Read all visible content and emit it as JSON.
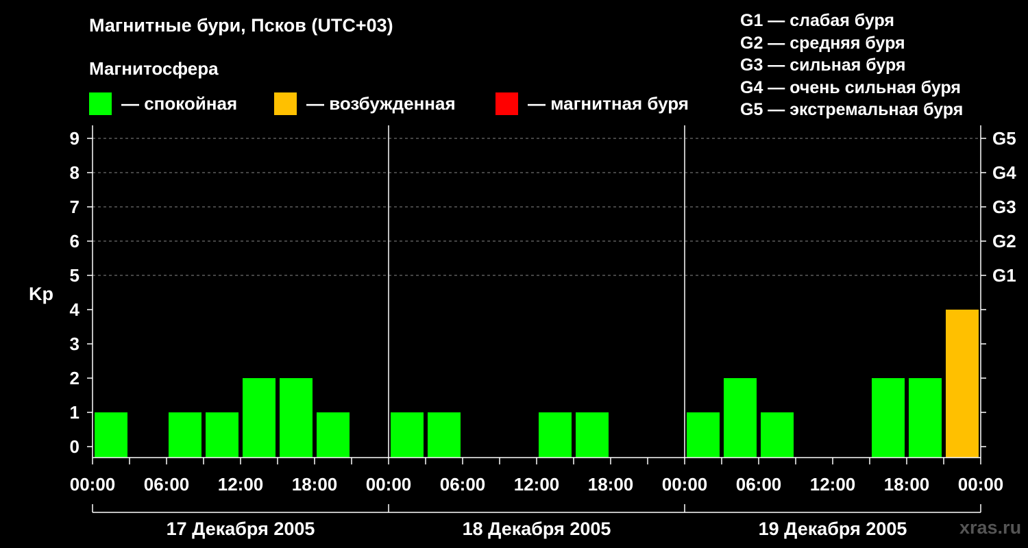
{
  "header": {
    "title": "Магнитные бури, Псков (UTC+03)",
    "subtitle": "Магнитосфера"
  },
  "legend": [
    {
      "label": "— спокойная",
      "color": "#00ff00"
    },
    {
      "label": "— возбужденная",
      "color": "#ffc000"
    },
    {
      "label": "— магнитная буря",
      "color": "#ff0000"
    }
  ],
  "storm_levels": [
    "G1 — слабая буря",
    "G2 — средняя буря",
    "G3 — сильная буря",
    "G4 — очень сильная буря",
    "G5 — экстремальная буря"
  ],
  "watermark": "xras.ru",
  "chart_data": {
    "type": "bar",
    "title": "Магнитные бури, Псков (UTC+03)",
    "ylabel": "Kp",
    "ylim": [
      0,
      9
    ],
    "yticks": [
      0,
      1,
      2,
      3,
      4,
      5,
      6,
      7,
      8,
      9
    ],
    "right_ticks": [
      {
        "value": 5,
        "label": "G1"
      },
      {
        "value": 6,
        "label": "G2"
      },
      {
        "value": 7,
        "label": "G3"
      },
      {
        "value": 8,
        "label": "G4"
      },
      {
        "value": 9,
        "label": "G5"
      }
    ],
    "xticks": [
      "00:00",
      "06:00",
      "12:00",
      "18:00",
      "00:00",
      "06:00",
      "12:00",
      "18:00",
      "00:00",
      "06:00",
      "12:00",
      "18:00",
      "00:00"
    ],
    "days": [
      "17 Декабря 2005",
      "18 Декабря 2005",
      "19 Декабря 2005"
    ],
    "interval_hours": 3,
    "values": [
      1,
      0,
      1,
      1,
      2,
      2,
      1,
      0,
      1,
      1,
      0,
      0,
      1,
      1,
      0,
      0,
      1,
      2,
      1,
      0,
      0,
      2,
      2,
      4
    ],
    "colors": {
      "quiet": "#00ff00",
      "active": "#ffc000",
      "storm": "#ff0000"
    },
    "grid": true
  }
}
